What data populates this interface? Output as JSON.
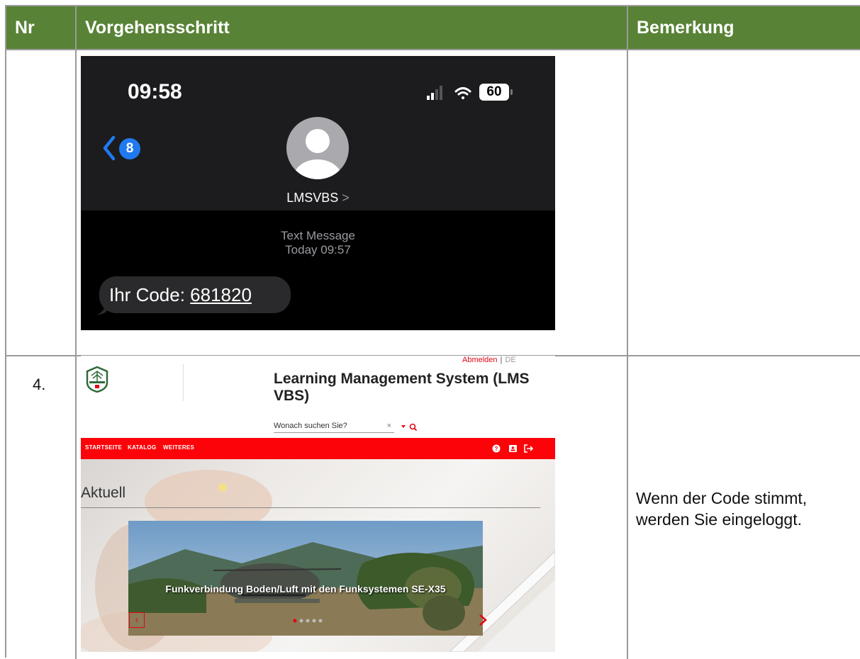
{
  "table": {
    "headers": [
      "Nr",
      "Vorgehensschritt",
      "Bemerkung"
    ],
    "header_color": "#588236"
  },
  "rows": [
    {
      "nr": "",
      "remark": "",
      "phone": {
        "time": "09:58",
        "battery": "60",
        "back_badge": "8",
        "contact": "LMSVBS",
        "contact_chevron": ">",
        "message_type": "Text Message",
        "message_time": "Today 09:57",
        "message_prefix": "Ihr Code: ",
        "message_code": "681820"
      }
    },
    {
      "nr": "4.",
      "remark_line1": "Wenn der Code stimmt,",
      "remark_line2": "werden Sie eingeloggt.",
      "lms": {
        "logout": "Abmelden",
        "separator": "|",
        "language": "DE",
        "title": "Learning Management System (LMS VBS)",
        "search_placeholder": "Wonach suchen Sie?",
        "search_clear": "×",
        "nav_items": [
          "STARTSEITE",
          "KATALOG",
          "WEITERES"
        ],
        "section_title": "Aktuell",
        "slide_caption": "Funkverbindung Boden/Luft mit den Funksystemen SE-X35",
        "slide_count": 5,
        "active_slide": 1,
        "brand_color": "#fb0309"
      }
    }
  ]
}
